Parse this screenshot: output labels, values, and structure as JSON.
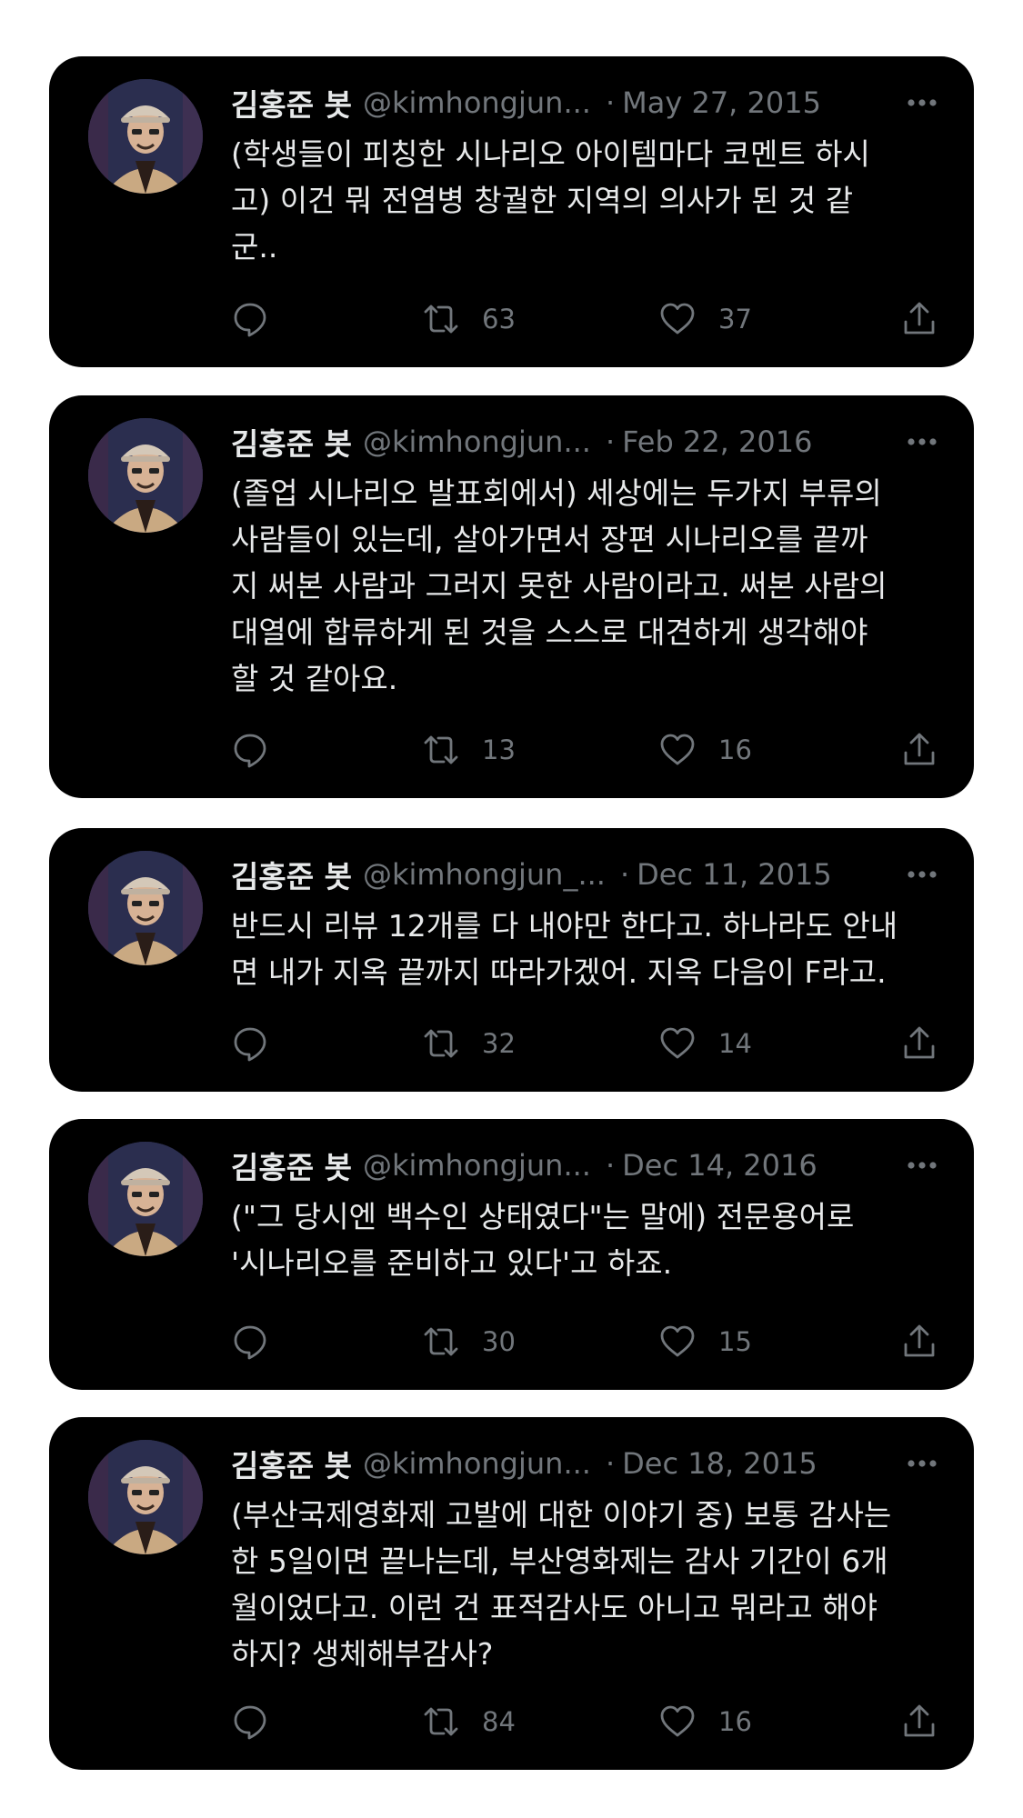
{
  "colors": {
    "card_background": "#000000",
    "page_background": "#ffffff",
    "text_primary": "#e7e9ea",
    "text_secondary": "#71767b"
  },
  "icons": {
    "more": "more-icon",
    "reply": "reply-icon",
    "retweet": "retweet-icon",
    "like": "heart-icon",
    "share": "share-icon"
  },
  "tweets": [
    {
      "name": "김홍준 봇",
      "handle": "@kimhongjun...",
      "separator": "·",
      "date": "May 27, 2015",
      "text": "(학생들이 피칭한 시나리오 아이템마다 코멘트 하시\n고) 이건 뭐 전염병 창궐한 지역의 의사가 된 것 같\n군..",
      "retweets": "63",
      "likes": "37"
    },
    {
      "name": "김홍준 봇",
      "handle": "@kimhongjun...",
      "separator": "·",
      "date": "Feb 22, 2016",
      "text": "(졸업 시나리오 발표회에서) 세상에는 두가지 부류의\n사람들이 있는데, 살아가면서 장편 시나리오를 끝까\n지 써본 사람과 그러지 못한 사람이라고. 써본 사람의\n대열에 합류하게 된 것을 스스로 대견하게 생각해야\n할 것 같아요.",
      "retweets": "13",
      "likes": "16"
    },
    {
      "name": "김홍준 봇",
      "handle": "@kimhongjun_...",
      "separator": "·",
      "date": "Dec 11, 2015",
      "text": "반드시 리뷰 12개를 다 내야만 한다고. 하나라도 안내\n면 내가 지옥 끝까지 따라가겠어. 지옥 다음이 F라고.",
      "retweets": "32",
      "likes": "14"
    },
    {
      "name": "김홍준 봇",
      "handle": "@kimhongjun...",
      "separator": "·",
      "date": "Dec 14, 2016",
      "text": "(\"그 당시엔 백수인 상태였다\"는 말에) 전문용어로\n'시나리오를 준비하고 있다'고 하죠.",
      "retweets": "30",
      "likes": "15"
    },
    {
      "name": "김홍준 봇",
      "handle": "@kimhongjun...",
      "separator": "·",
      "date": "Dec 18, 2015",
      "text": "(부산국제영화제 고발에 대한 이야기 중) 보통 감사는\n한 5일이면 끝나는데, 부산영화제는 감사 기간이 6개\n월이었다고. 이런 건 표적감사도 아니고 뭐라고 해야\n하지? 생체해부감사?",
      "retweets": "84",
      "likes": "16"
    }
  ]
}
